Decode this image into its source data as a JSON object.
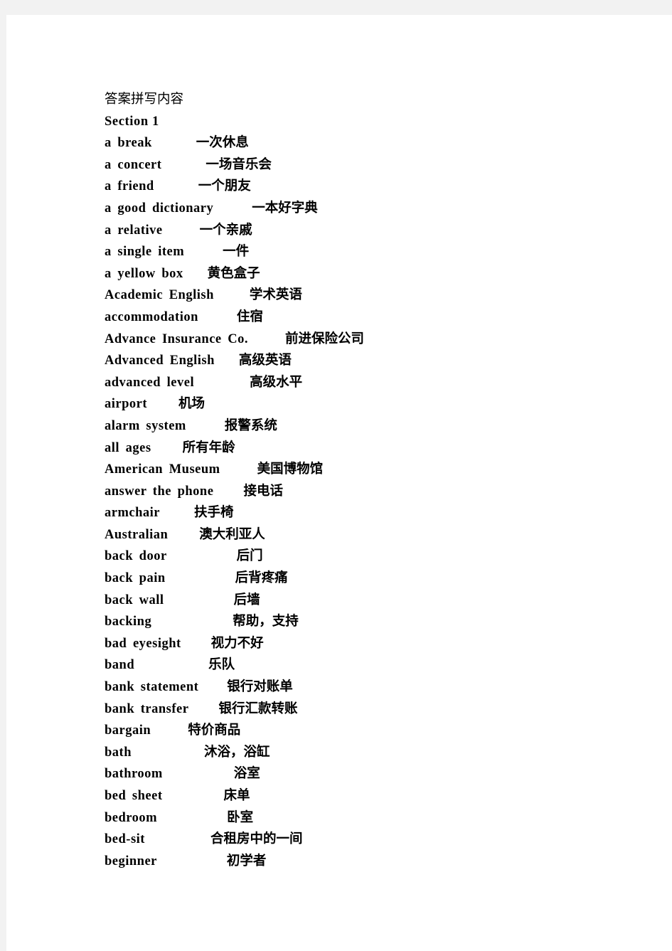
{
  "document": {
    "title": "答案拼写内容",
    "section_heading": "Section 1",
    "entries": [
      {
        "term": "a break",
        "gloss": "一次休息",
        "gap": 62
      },
      {
        "term": "a concert",
        "gloss": "一场音乐会",
        "gap": 62
      },
      {
        "term": "a friend",
        "gloss": "一个朋友",
        "gap": 62
      },
      {
        "term": "a good dictionary",
        "gloss": "一本好字典",
        "gap": 54
      },
      {
        "term": "a relative",
        "gloss": "一个亲戚",
        "gap": 52
      },
      {
        "term": "a single item",
        "gloss": "一件",
        "gap": 54
      },
      {
        "term": "a yellow box",
        "gloss": "黄色盒子",
        "gap": 34
      },
      {
        "term": "Academic English",
        "gloss": "学术英语",
        "gap": 50
      },
      {
        "term": "accommodation",
        "gloss": "住宿",
        "gap": 54
      },
      {
        "term": "Advance Insurance Co.",
        "gloss": "前进保险公司",
        "gap": 52
      },
      {
        "term": "Advanced English",
        "gloss": "高级英语",
        "gap": 34
      },
      {
        "term": "advanced level",
        "gloss": "高级水平",
        "gap": 78
      },
      {
        "term": "airport",
        "gloss": "机场",
        "gap": 44
      },
      {
        "term": "alarm system",
        "gloss": "报警系统",
        "gap": 54
      },
      {
        "term": "all ages",
        "gloss": "所有年龄",
        "gap": 44
      },
      {
        "term": "American Museum",
        "gloss": "美国博物馆",
        "gap": 52
      },
      {
        "term": "answer the phone",
        "gloss": "接电话",
        "gap": 42
      },
      {
        "term": "armchair",
        "gloss": "扶手椅",
        "gap": 48
      },
      {
        "term": "Australian",
        "gloss": "澳大利亚人",
        "gap": 44
      },
      {
        "term": "back door",
        "gloss": "后门",
        "gap": 98
      },
      {
        "term": "back pain",
        "gloss": "后背疼痛",
        "gap": 98
      },
      {
        "term": "back wall",
        "gloss": "后墙",
        "gap": 98
      },
      {
        "term": "backing",
        "gloss": "帮助，支持",
        "gap": 114
      },
      {
        "term": "bad eyesight",
        "gloss": "视力不好",
        "gap": 42
      },
      {
        "term": "band",
        "gloss": "乐队",
        "gap": 104
      },
      {
        "term": "bank statement",
        "gloss": "银行对账单",
        "gap": 40
      },
      {
        "term": "bank transfer",
        "gloss": "银行汇款转账",
        "gap": 42
      },
      {
        "term": "bargain",
        "gloss": "特价商品",
        "gap": 52
      },
      {
        "term": "bath",
        "gloss": "沐浴，浴缸",
        "gap": 102
      },
      {
        "term": "bathroom",
        "gloss": "浴室",
        "gap": 100
      },
      {
        "term": "bed sheet",
        "gloss": "床单",
        "gap": 86
      },
      {
        "term": "bedroom",
        "gloss": "卧室",
        "gap": 98
      },
      {
        "term": "bed-sit",
        "gloss": "合租房中的一间",
        "gap": 92
      },
      {
        "term": "beginner",
        "gloss": "初学者",
        "gap": 98
      }
    ]
  }
}
